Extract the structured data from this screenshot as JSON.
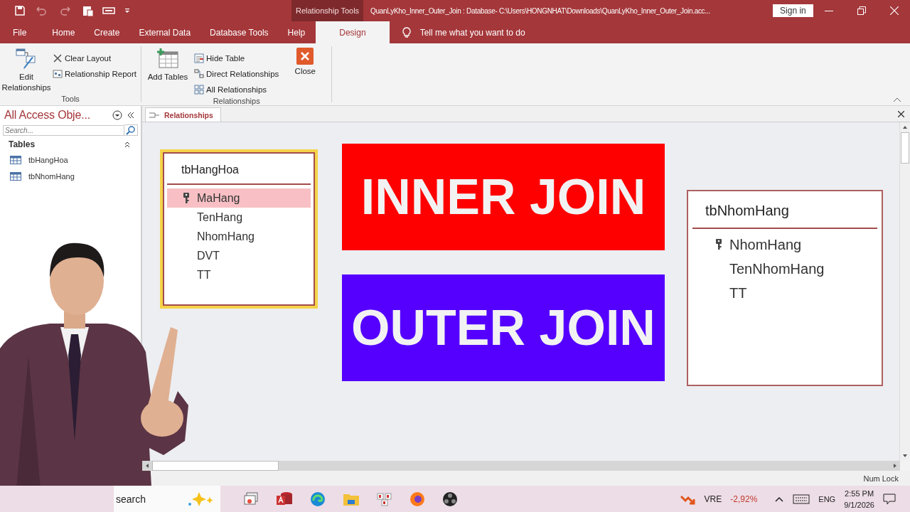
{
  "title_bar": {
    "context_tab": "Relationship Tools",
    "title": "QuanLyKho_Inner_Outer_Join : Database- C:\\Users\\HONGNHAT\\Downloads\\QuanLyKho_Inner_Outer_Join.acc...",
    "sign_in": "Sign in"
  },
  "ribbon_tabs": [
    {
      "label": "File",
      "selected": false
    },
    {
      "label": "Home",
      "selected": false
    },
    {
      "label": "Create",
      "selected": false
    },
    {
      "label": "External Data",
      "selected": false
    },
    {
      "label": "Database Tools",
      "selected": false
    },
    {
      "label": "Help",
      "selected": false
    },
    {
      "label": "Design",
      "selected": true
    }
  ],
  "tell_me": "Tell me what you want to do",
  "ribbon": {
    "edit_relationships": "Edit Relationships",
    "clear_layout": "Clear Layout",
    "relationship_report": "Relationship Report",
    "tools_group": "Tools",
    "add_tables": "Add Tables",
    "hide_table": "Hide Table",
    "direct_relationships": "Direct Relationships",
    "all_relationships": "All Relationships",
    "close": "Close",
    "relationships_group": "Relationships"
  },
  "nav_pane": {
    "title": "All Access Obje...",
    "search_placeholder": "Search...",
    "group": "Tables",
    "items": [
      {
        "label": "tbHangHoa"
      },
      {
        "label": "tbNhomHang"
      }
    ]
  },
  "document_tab": "Relationships",
  "tables": [
    {
      "name": "tbHangHoa",
      "selected": true,
      "fields": [
        {
          "name": "MaHang",
          "key": true,
          "selected": true
        },
        {
          "name": "TenHang",
          "key": false,
          "selected": false
        },
        {
          "name": "NhomHang",
          "key": false,
          "selected": false
        },
        {
          "name": "DVT",
          "key": false,
          "selected": false
        },
        {
          "name": "TT",
          "key": false,
          "selected": false
        }
      ]
    },
    {
      "name": "tbNhomHang",
      "selected": false,
      "fields": [
        {
          "name": "NhomHang",
          "key": true,
          "selected": false
        },
        {
          "name": "TenNhomHang",
          "key": false,
          "selected": false
        },
        {
          "name": "TT",
          "key": false,
          "selected": false
        }
      ]
    }
  ],
  "banners": [
    {
      "text": "INNER JOIN",
      "color": "#ff0000"
    },
    {
      "text": "OUTER JOIN",
      "color": "#5500ff"
    }
  ],
  "status_bar": "Num Lock",
  "taskbar": {
    "search": "search",
    "ticker_symbol": "VRE",
    "ticker_change": "-2,92%",
    "language": "ENG",
    "time": "2:55 PM",
    "date": "9/1/2026"
  }
}
